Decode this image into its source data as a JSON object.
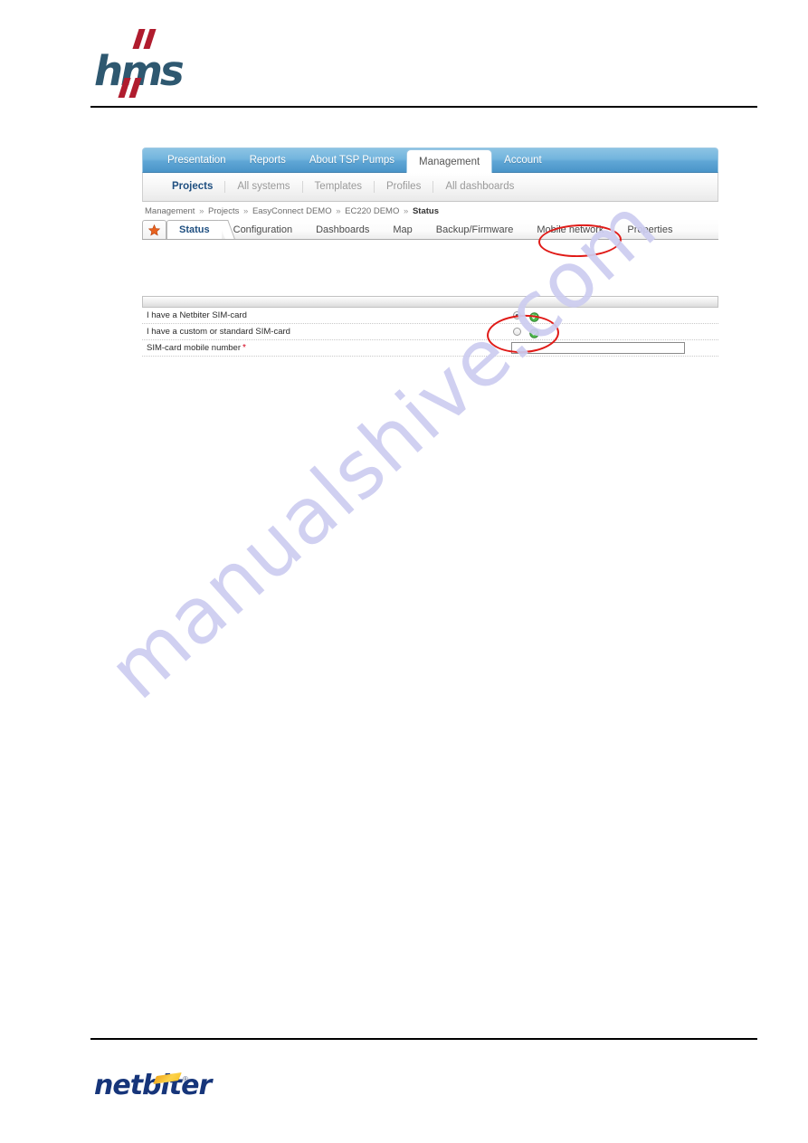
{
  "document": {
    "vendor_logo_text": "hms",
    "footer_logo_text": "netbiter",
    "footer_logo_registered": "®",
    "watermark_text": "manualshive.com"
  },
  "main_nav": {
    "items": [
      {
        "label": "Presentation",
        "active": false
      },
      {
        "label": "Reports",
        "active": false
      },
      {
        "label": "About TSP Pumps",
        "active": false
      },
      {
        "label": "Management",
        "active": true
      },
      {
        "label": "Account",
        "active": false
      }
    ]
  },
  "sub_nav": {
    "items": [
      {
        "label": "Projects",
        "active": true
      },
      {
        "label": "All systems",
        "active": false
      },
      {
        "label": "Templates",
        "active": false
      },
      {
        "label": "Profiles",
        "active": false
      },
      {
        "label": "All dashboards",
        "active": false
      }
    ]
  },
  "breadcrumb": {
    "separator": "»",
    "items": [
      "Management",
      "Projects",
      "EasyConnect DEMO",
      "EC220 DEMO"
    ],
    "current": "Status"
  },
  "device_tabs": {
    "favorite_icon": "star-icon",
    "items": [
      {
        "label": "Status",
        "active": true
      },
      {
        "label": "Configuration",
        "active": false
      },
      {
        "label": "Dashboards",
        "active": false
      },
      {
        "label": "Map",
        "active": false
      },
      {
        "label": "Backup/Firmware",
        "active": false
      },
      {
        "label": "Mobile network",
        "active": false
      },
      {
        "label": "Properties",
        "active": false
      }
    ]
  },
  "form": {
    "section_header_label": "",
    "rows": [
      {
        "label": "I have a Netbiter SIM-card",
        "control": "radio",
        "checked": true,
        "required": false,
        "help_icon": "help-green-icon"
      },
      {
        "label": "I have a custom or standard SIM-card",
        "control": "radio",
        "checked": false,
        "required": false,
        "help_icon": "help-green-icon"
      },
      {
        "label": "SIM-card mobile number",
        "control": "text",
        "value": "",
        "required": true,
        "required_marker": "*"
      }
    ]
  },
  "annotations": {
    "accent_color": "#e01a17",
    "items": [
      {
        "name": "mobile-network-tab-highlight",
        "target": "Mobile network"
      },
      {
        "name": "netbiter-simcard-radio-highlight",
        "target": "I have a Netbiter SIM-card"
      }
    ]
  },
  "colors": {
    "nav_blue": "#5fa6d5",
    "active_link": "#1f4f80",
    "required_red": "#d4001a",
    "annotation_red": "#e01a17",
    "hms_blue": "#2e5870",
    "hms_red": "#b01c2e",
    "netbiter_blue": "#16357a",
    "netbiter_orange": "#f8c52e",
    "watermark": "#cdcdf0"
  }
}
